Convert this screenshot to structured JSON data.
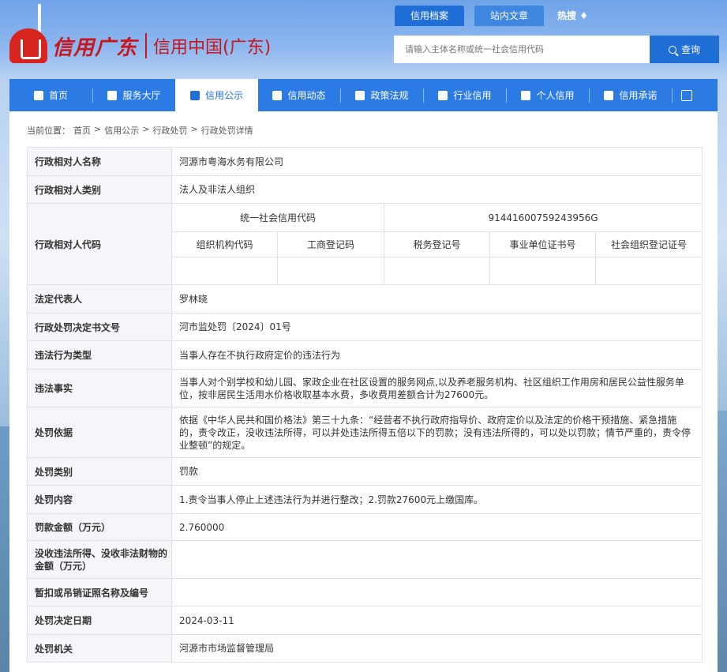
{
  "header": {
    "logo_cn": "信用广东",
    "logo_sub": "信用中国(广东)",
    "tabs": [
      "信用档案",
      "站内文章"
    ],
    "hot_label": "热搜",
    "search_placeholder": "请输入主体名称或统一社会信用代码",
    "search_button": "查询"
  },
  "nav": {
    "items": [
      "首页",
      "服务大厅",
      "信用公示",
      "信用动态",
      "政策法规",
      "行业信用",
      "个人信用",
      "信用承诺"
    ]
  },
  "breadcrumb": {
    "prefix": "当前位置：",
    "items": [
      "首页",
      ">",
      "信用公示",
      ">",
      "行政处罚",
      ">",
      "行政处罚详情"
    ]
  },
  "detail": {
    "name_label": "行政相对人名称",
    "name_value": "河源市粤海水务有限公司",
    "type_label": "行政相对人类别",
    "type_value": "法人及非法人组织",
    "code_label": "行政相对人代码",
    "usc_label": "统一社会信用代码",
    "usc_value": "91441600759243956G",
    "code_subs": [
      "组织机构代码",
      "工商登记码",
      "税务登记号",
      "事业单位证书号",
      "社会组织登记证号"
    ],
    "rep_label": "法定代表人",
    "rep_value": "罗林晓",
    "doc_label": "行政处罚决定书文号",
    "doc_value": "河市监处罚〔2024〕01号",
    "vtype_label": "违法行为类型",
    "vtype_value": "当事人存在不执行政府定价的违法行为",
    "fact_label": "违法事实",
    "fact_value": "当事人对个别学校和幼儿园、家政企业在社区设置的服务网点,以及养老服务机构、社区组织工作用房和居民公益性服务单位，按非居民生活用水价格收取基本水费，多收费用差额合计为27600元。",
    "basis_label": "处罚依据",
    "basis_value": "依据《中华人民共和国价格法》第三十九条：“经营者不执行政府指导价、政府定价以及法定的价格干预措施、紧急措施的，责令改正，没收违法所得，可以并处违法所得五倍以下的罚款；没有违法所得的，可以处以罚款；情节严重的，责令停业整顿”的规定。",
    "ptype_label": "处罚类别",
    "ptype_value": "罚款",
    "content_label": "处罚内容",
    "content_value": "1.责令当事人停止上述违法行为并进行整改；2.罚款27600元上缴国库。",
    "fine_label": "罚款金额（万元）",
    "fine_value": "2.760000",
    "confis_label": "没收违法所得、没收非法财物的金额（万元）",
    "confis_value": "",
    "license_label": "暂扣或吊销证照名称及编号",
    "license_value": "",
    "date_label": "处罚决定日期",
    "date_value": "2024-03-11",
    "org_label": "处罚机关",
    "org_value": "河源市市场监督管理局"
  }
}
